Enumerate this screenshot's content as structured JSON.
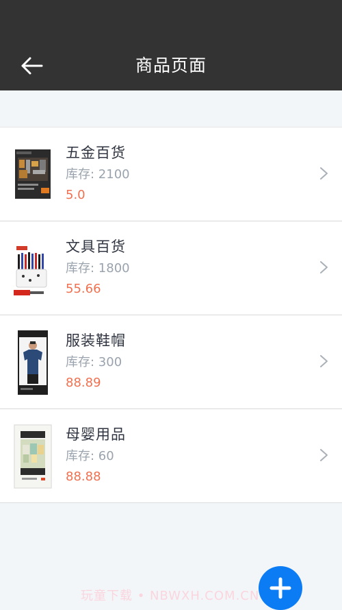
{
  "header": {
    "title": "商品页面",
    "background_color": "#333333"
  },
  "products": [
    {
      "name": "五金百货",
      "stock": "库存: 2100",
      "price": "5.0",
      "thumb_icon": "hardware-toolkit-image"
    },
    {
      "name": "文具百货",
      "stock": "库存: 1800",
      "price": "55.66",
      "thumb_icon": "stationery-pens-image"
    },
    {
      "name": "服装鞋帽",
      "stock": "库存: 300",
      "price": "88.89",
      "thumb_icon": "tshirt-model-image"
    },
    {
      "name": "母婴用品",
      "stock": "库存: 60",
      "price": "88.88",
      "thumb_icon": "baby-clothes-image"
    }
  ],
  "watermark": "玩童下载 • NBWXH.COM.CN",
  "colors": {
    "accent": "#0c7cf5",
    "price": "#f0704f",
    "page_background": "#f2f6f9"
  },
  "fab": {
    "icon": "plus-icon"
  }
}
